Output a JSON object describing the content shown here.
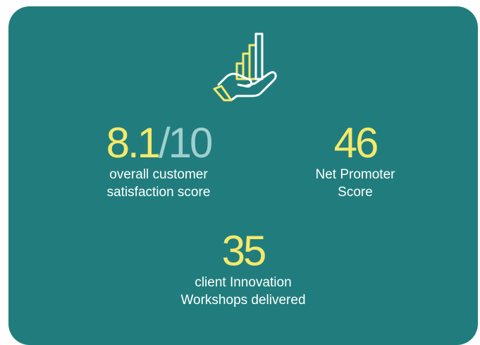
{
  "colors": {
    "card_background": "#217d7d",
    "accent_yellow": "#f5e96a",
    "muted_teal_text": "#9fd0cf",
    "label_text": "#ffffff"
  },
  "icon": {
    "name": "hand-holding-growth-chart-icon"
  },
  "stats": {
    "csat": {
      "value": "8.1",
      "denominator": "/10",
      "label_line1": "overall customer",
      "label_line2": "satisfaction score"
    },
    "nps": {
      "value": "46",
      "label_line1": "Net Promoter",
      "label_line2": "Score"
    },
    "workshops": {
      "value": "35",
      "label_line1": "client Innovation",
      "label_line2": "Workshops delivered"
    }
  }
}
